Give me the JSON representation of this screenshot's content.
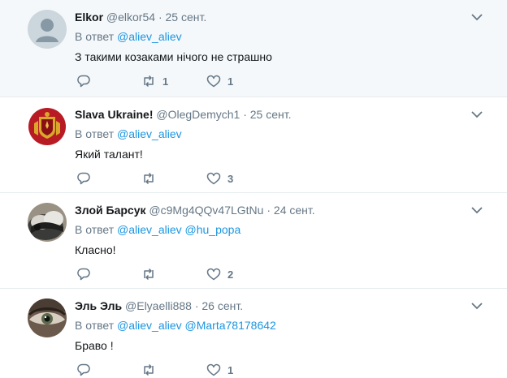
{
  "reply_prefix": "В ответ",
  "tweets": [
    {
      "name": "Elkor",
      "handle": "@elkor54",
      "separator": "·",
      "time": "25 сент.",
      "mentions": [
        "@aliev_aliev"
      ],
      "text": "З такими козаками нічого не страшно",
      "retweets": "1",
      "likes": "1",
      "avatar_icon": "default-avatar-icon"
    },
    {
      "name": "Slava Ukraine!",
      "handle": "@OlegDemych1",
      "separator": "·",
      "time": "25 сент.",
      "mentions": [
        "@aliev_aliev"
      ],
      "text": "Який талант!",
      "retweets": "",
      "likes": "3",
      "avatar_icon": "coat-of-arms-icon"
    },
    {
      "name": "Злой Барсук",
      "handle": "@c9Mg4QQv47LGtNu",
      "separator": "·",
      "time": "24 сент.",
      "mentions": [
        "@aliev_aliev",
        "@hu_popa"
      ],
      "text": "Класно!",
      "retweets": "",
      "likes": "2",
      "avatar_icon": "badger-photo-icon"
    },
    {
      "name": "Эль Эль",
      "handle": "@Elyaelli888",
      "separator": "·",
      "time": "26 сент.",
      "mentions": [
        "@aliev_aliev",
        "@Marta78178642"
      ],
      "text": "Браво !",
      "retweets": "",
      "likes": "1",
      "avatar_icon": "eye-photo-icon"
    }
  ],
  "colors": {
    "link": "#1b95e0",
    "muted": "#657786",
    "highlight_bg": "#f5f8fa",
    "border": "#e6ecf0"
  }
}
